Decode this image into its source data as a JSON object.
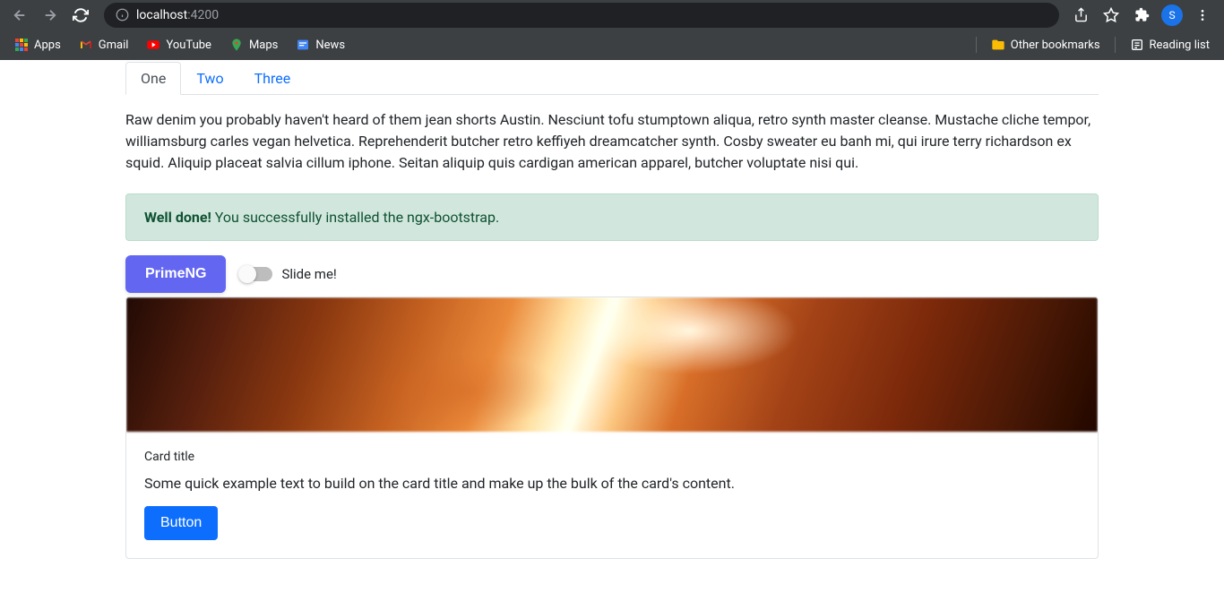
{
  "browser": {
    "url_host": "localhost",
    "url_port": ":4200",
    "avatar_initial": "S"
  },
  "bookmarks": {
    "apps": "Apps",
    "gmail": "Gmail",
    "youtube": "YouTube",
    "maps": "Maps",
    "news": "News",
    "other": "Other bookmarks",
    "reading": "Reading list"
  },
  "tabs": {
    "items": [
      {
        "label": "One"
      },
      {
        "label": "Two"
      },
      {
        "label": "Three"
      }
    ],
    "content": "Raw denim you probably haven't heard of them jean shorts Austin. Nesciunt tofu stumptown aliqua, retro synth master cleanse. Mustache cliche tempor, williamsburg carles vegan helvetica. Reprehenderit butcher retro keffiyeh dreamcatcher synth. Cosby sweater eu banh mi, qui irure terry richardson ex squid. Aliquip placeat salvia cillum iphone. Seitan aliquip quis cardigan american apparel, butcher voluptate nisi qui."
  },
  "alert": {
    "strong": "Well done!",
    "text": " You successfully installed the ngx-bootstrap."
  },
  "controls": {
    "primeng": "PrimeNG",
    "toggle_label": "Slide me!"
  },
  "card": {
    "title": "Card title",
    "text": "Some quick example text to build on the card title and make up the bulk of the card's content.",
    "button": "Button"
  }
}
